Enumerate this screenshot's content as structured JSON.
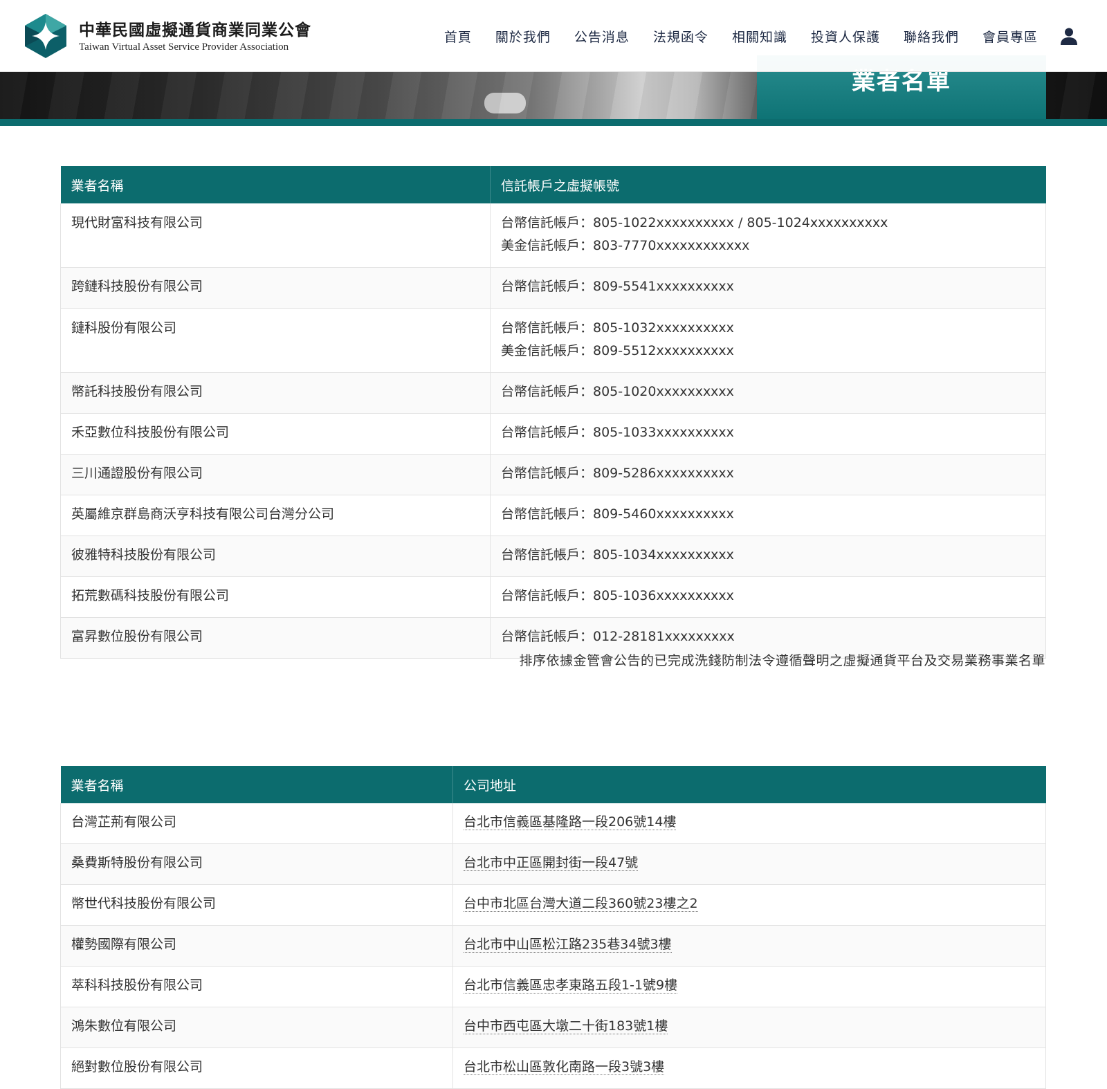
{
  "header": {
    "brand_cn": "中華民國虛擬通貨商業同業公會",
    "brand_en": "Taiwan Virtual Asset Service Provider Association",
    "page_title": "業者名單",
    "nav": [
      {
        "label": "首頁"
      },
      {
        "label": "關於我們"
      },
      {
        "label": "公告消息"
      },
      {
        "label": "法規函令"
      },
      {
        "label": "相關知識"
      },
      {
        "label": "投資人保護"
      },
      {
        "label": "聯絡我們"
      },
      {
        "label": "會員專區"
      }
    ],
    "user_icon": "user-icon"
  },
  "accounts_table": {
    "headers": [
      "業者名稱",
      "信託帳戶之虛擬帳號"
    ],
    "rows": [
      {
        "name": "現代財富科技有限公司",
        "lines": [
          "台幣信託帳戶：805-1022xxxxxxxxxx / 805-1024xxxxxxxxxx",
          "美金信託帳戶：803-7770xxxxxxxxxxxx"
        ]
      },
      {
        "name": "跨鏈科技股份有限公司",
        "lines": [
          "台幣信託帳戶：809-5541xxxxxxxxxx"
        ]
      },
      {
        "name": "鏈科股份有限公司",
        "lines": [
          "台幣信託帳戶：805-1032xxxxxxxxxx",
          "美金信託帳戶：809-5512xxxxxxxxxx"
        ]
      },
      {
        "name": "幣託科技股份有限公司",
        "lines": [
          "台幣信託帳戶：805-1020xxxxxxxxxx"
        ]
      },
      {
        "name": "禾亞數位科技股份有限公司",
        "lines": [
          "台幣信託帳戶：805-1033xxxxxxxxxx"
        ]
      },
      {
        "name": "三川通證股份有限公司",
        "lines": [
          "台幣信託帳戶：809-5286xxxxxxxxxx"
        ]
      },
      {
        "name": "英屬維京群島商沃亨科技有限公司台灣分公司",
        "lines": [
          "台幣信託帳戶：809-5460xxxxxxxxxx"
        ]
      },
      {
        "name": "彼雅特科技股份有限公司",
        "lines": [
          "台幣信託帳戶：805-1034xxxxxxxxxx"
        ]
      },
      {
        "name": "拓荒數碼科技股份有限公司",
        "lines": [
          "台幣信託帳戶：805-1036xxxxxxxxxx"
        ]
      },
      {
        "name": "富昇數位股份有限公司",
        "lines": [
          "台幣信託帳戶：012-28181xxxxxxxxx"
        ]
      }
    ],
    "note": "排序依據金管會公告的已完成洗錢防制法令遵循聲明之虛擬通貨平台及交易業務事業名單"
  },
  "address_table": {
    "headers": [
      "業者名稱",
      "公司地址"
    ],
    "rows": [
      {
        "name": "台灣芷荊有限公司",
        "address": "台北市信義區基隆路一段206號14樓"
      },
      {
        "name": "桑費斯特股份有限公司",
        "address": "台北市中正區開封街一段47號"
      },
      {
        "name": "幣世代科技股份有限公司",
        "address": "台中市北區台灣大道二段360號23樓之2"
      },
      {
        "name": "權勢國際有限公司",
        "address": "台北市中山區松江路235巷34號3樓"
      },
      {
        "name": "萃科科技股份有限公司",
        "address": "台北市信義區忠孝東路五段1-1號9樓"
      },
      {
        "name": "鴻朱數位有限公司",
        "address": "台中市西屯區大墩二十街183號1樓"
      },
      {
        "name": "絕對數位股份有限公司",
        "address": "台北市松山區敦化南路一段3號3樓"
      }
    ]
  },
  "colors": {
    "accent": "#0c6c6e",
    "nav_text": "#1e2a44",
    "body_text": "#333333"
  }
}
